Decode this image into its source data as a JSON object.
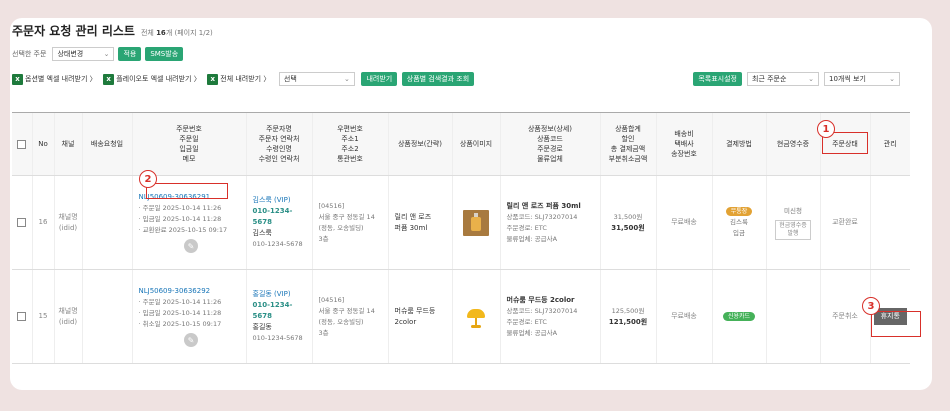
{
  "page": {
    "title": "주문자 요청 관리 리스트",
    "count_prefix": "전체",
    "count_value": "16",
    "count_suffix": "개 (페이지 1/2)"
  },
  "selection": {
    "label": "선택한 주문",
    "status_select": "상태변경",
    "apply_button": "적용",
    "sms_button": "SMS발송"
  },
  "toolbar": {
    "excel_options": "옵션별 엑셀 내려받기 〉",
    "excel_playauto": "플레이오토 엑셀 내려받기 〉",
    "excel_all": "전체 내려받기 〉",
    "download_select": "선택",
    "download_button": "내려받기",
    "search_result_button": "상품별 검색결과 조회",
    "display_settings_button": "목록표시설정",
    "sort_select": "최근 주문순",
    "page_size_select": "10개씩 보기"
  },
  "table": {
    "headers": {
      "no": "No",
      "channel": "채널",
      "delivery_req": "배송요청일",
      "order": [
        "주문번호",
        "주문일",
        "입금일",
        "메모"
      ],
      "orderer": [
        "주문자명",
        "주문자 연락처",
        "수령인명",
        "수령인 연락처"
      ],
      "address": [
        "우편번호",
        "주소1",
        "주소2",
        "통관번호"
      ],
      "product_short": "상품정보(간략)",
      "product_image": "상품이미지",
      "product_detail": [
        "상품정보(상세)",
        "상품코드",
        "주문경로",
        "물류업체"
      ],
      "total": [
        "상품합계",
        "할인",
        "총 결제금액",
        "부분취소금액"
      ],
      "shipping": [
        "배송비",
        "택배사",
        "송장번호"
      ],
      "payment": "결제방법",
      "cash_receipt": "현금영수증",
      "order_status": "주문상태",
      "manage": "관리"
    },
    "rows": [
      {
        "no": "16",
        "channel": [
          "채널명",
          "(idid)"
        ],
        "order_no": "NLJ50609-30636291",
        "dates": [
          "· 주문일 2025-10-14 11:26",
          "· 입금일 2025-10-14 11:28",
          "· 교환완료 2025-10-15 09:17"
        ],
        "orderer": "김스룩 (VIP)",
        "orderer_phone": "010-1234-5678",
        "receiver": "김스룩",
        "receiver_phone": "010-1234-5678",
        "address": [
          "[04516]",
          "서울 중구 정동길 14",
          "(정동, 오송빌딩)",
          "3층"
        ],
        "product_short": [
          "릴리 앤 로즈",
          "퍼퓸 30ml"
        ],
        "product_name": "릴리 앤 로즈 퍼퓸 30ml",
        "product_code": "상품코드: SLJ73207014",
        "order_route": "주문경로: ETC",
        "logistics": "물류업체: 공급사A",
        "price": "31,500원",
        "total": "31,500원",
        "shipping": "무료배송",
        "pay_badge": "무통장",
        "pay_name": "김스룩",
        "pay_type": "입금",
        "cash_status": "미신청",
        "cash_button": [
          "현금영수증",
          "발행"
        ],
        "status": "교환완료",
        "manage": ""
      },
      {
        "no": "15",
        "channel": [
          "채널명",
          "(idid)"
        ],
        "order_no": "NLJ50609-30636292",
        "dates": [
          "· 주문일 2025-10-14 11:26",
          "· 입금일 2025-10-14 11:28",
          "· 취소일 2025-10-15 09:17"
        ],
        "orderer": "홍길동 (VIP)",
        "orderer_phone": "010-1234-5678",
        "receiver": "홍길동",
        "receiver_phone": "010-1234-5678",
        "address": [
          "[04516]",
          "서울 중구 정동길 14",
          "(정동, 오송빌딩)",
          "3층"
        ],
        "product_short": [
          "머슈룸 무드등",
          "2color"
        ],
        "product_name": "머슈룸 무드등 2color",
        "product_code": "상품코드: SLJ73207014",
        "order_route": "주문경로: ETC",
        "logistics": "물류업체: 공급사A",
        "price": "125,500원",
        "total": "121,500원",
        "shipping": "무료배송",
        "pay_badge": "신용카드",
        "status": "주문취소",
        "manage": "휴지통"
      }
    ]
  },
  "annotations": [
    "1",
    "2",
    "3"
  ],
  "colors": {
    "background": "#efe2e1",
    "accent_green": "#2aa574",
    "highlight_red": "#d8302a",
    "link_blue": "#1976b8",
    "phone_teal": "#2a8f86"
  }
}
